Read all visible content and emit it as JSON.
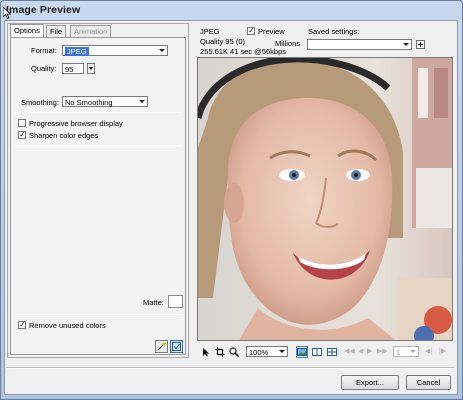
{
  "window": {
    "title": "Image Preview"
  },
  "tabs": [
    {
      "label": "Options",
      "active": true
    },
    {
      "label": "File",
      "active": false
    },
    {
      "label": "Animation",
      "active": false,
      "disabled": true
    }
  ],
  "options": {
    "format_label": "Format:",
    "format_value": "JPEG",
    "quality_label": "Quality:",
    "quality_value": "95",
    "smoothing_label": "Smoothing:",
    "smoothing_value": "No Smoothing",
    "progressive_label": "Progressive browser display",
    "progressive_checked": false,
    "sharpen_label": "Sharpen color edges",
    "sharpen_checked": true,
    "matte_label": "Matte:",
    "matte_color": "#ffffff",
    "remove_unused_label": "Remove unused colors",
    "remove_unused_checked": true
  },
  "info": {
    "format": "JPEG",
    "quality_line": "Quality 95 (0)",
    "size_line": "255.61K  41 sec @56kbps",
    "preview_label": "Preview",
    "preview_checked": true,
    "colors": "Millions",
    "saved_settings_label": "Saved settings:",
    "saved_settings_value": ""
  },
  "viewbar": {
    "zoom_value": "100%",
    "frame_value": "1"
  },
  "buttons": {
    "export": "Export...",
    "cancel": "Cancel"
  },
  "icons": {
    "pointer": "pointer-icon",
    "crop": "crop-icon",
    "zoom": "magnifier-icon",
    "magic": "magic-wand-icon",
    "optimize": "optimize-size-icon",
    "add": "plus-icon",
    "view1": "single-view-icon",
    "view2": "two-up-view-icon",
    "view4": "four-up-view-icon"
  },
  "colors": {
    "accent": "#3a73d8",
    "title_bar": "#aec4e0"
  }
}
